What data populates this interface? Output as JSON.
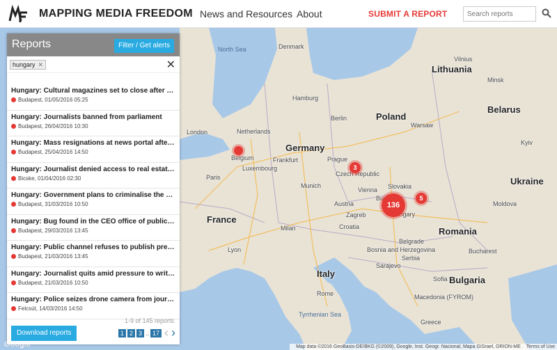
{
  "header": {
    "brand": "MAPPING MEDIA FREEDOM",
    "nav": [
      {
        "label": "News and Resources"
      },
      {
        "label": "About"
      }
    ],
    "submit_label": "SUBMIT A REPORT",
    "search_placeholder": "Search reports"
  },
  "panel": {
    "title": "Reports",
    "filter_button": "Filter / Get alerts",
    "active_tag": "hungary",
    "reports": [
      {
        "title": "Hungary: Cultural magazines set to close after cuts",
        "meta": "Budapest, 01/05/2016 05:25"
      },
      {
        "title": "Hungary: Journalists banned from parliament",
        "meta": "Budapest, 26/04/2016 10:30"
      },
      {
        "title": "Hungary: Mass resignations at news portal after re...",
        "meta": "Budapest, 25/04/2016 14:50"
      },
      {
        "title": "Hungary: Journalist denied access to real estate da...",
        "meta": "Bicske, 01/04/2016 02:30"
      },
      {
        "title": "Hungary: Government plans to criminalise the use...",
        "meta": "Budapest, 31/03/2016 10:50"
      },
      {
        "title": "Hungary: Bug found in the CEO office of public me...",
        "meta": "Budapest, 29/03/2016 13:45"
      },
      {
        "title": "Hungary: Public channel refuses to publish press r...",
        "meta": "Budapest, 21/03/2016 13:45"
      },
      {
        "title": "Hungary: Journalist quits amid pressure to write d...",
        "meta": "Budapest, 21/03/2016 10:50"
      },
      {
        "title": "Hungary: Police seizes drone camera from journal...",
        "meta": "Felcsút, 14/03/2016 14:50"
      }
    ],
    "count_text": "1-9 of 145 reports",
    "download_label": "Download reports",
    "pages": [
      "1",
      "2",
      "3",
      "17"
    ],
    "page_ellipsis": ".."
  },
  "map": {
    "labels": {
      "north_sea": "North Sea",
      "denmark": "Denmark",
      "lithuania": "Lithuania",
      "belarus": "Belarus",
      "poland": "Poland",
      "germany": "Germany",
      "netherlands": "Netherlands",
      "belgium": "Belgium",
      "luxembourg": "Luxembourg",
      "czech": "Czech Republic",
      "slovakia": "Slovakia",
      "austria": "Austria",
      "hungary": "Hungary",
      "ukraine": "Ukraine",
      "moldova": "Moldova",
      "france": "France",
      "romania": "Romania",
      "croatia": "Croatia",
      "bosnia": "Bosnia and Herzegovina",
      "serbia": "Serbia",
      "italy": "Italy",
      "bulgaria": "Bulgaria",
      "macedonia": "Macedonia (FYROM)",
      "greece": "Greece",
      "tyrrhenian": "Tyrrhenian Sea",
      "london": "London",
      "paris": "Paris",
      "berlin": "Berlin",
      "warsaw": "Warsaw",
      "prague": "Prague",
      "vienna": "Vienna",
      "budapest": "Budapest",
      "hamburg": "Hamburg",
      "munich": "Munich",
      "milan": "Milan",
      "rome": "Rome",
      "belgrade": "Belgrade",
      "bucharest": "Bucharest",
      "sofia": "Sofia",
      "kyiv": "Kyiv",
      "minsk": "Minsk",
      "vilnius": "Vilnius",
      "frankfurt": "Frankfurt",
      "zagreb": "Zagreb",
      "sarajevo": "Sarajevo",
      "lyon": "Lyon"
    },
    "clusters": [
      {
        "count": "136"
      },
      {
        "count": "5"
      },
      {
        "count": "3"
      },
      {
        "count": ""
      }
    ],
    "attribution": "Map data ©2016 GeoBasis-DE/BKG (©2009), Google, Inst. Geogr. Nacional, Mapa GISrael, ORION-ME",
    "terms": "Terms of Use",
    "google": "Google"
  },
  "colors": {
    "accent_red": "#e53935",
    "button_blue": "#29abe2",
    "page_blue": "#2a76a8",
    "panel_header": "#888888"
  }
}
